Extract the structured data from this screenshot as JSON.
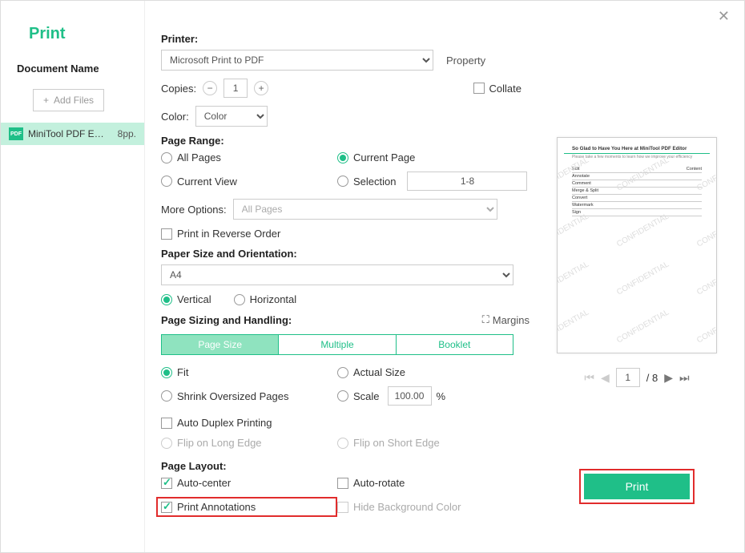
{
  "dialog_title": "Print",
  "left": {
    "doc_label": "Document Name",
    "add_files": "Add Files",
    "file": {
      "name": "MiniTool PDF E…",
      "pages": "8pp."
    }
  },
  "printer": {
    "label": "Printer:",
    "value": "Microsoft Print to PDF",
    "property": "Property"
  },
  "copies": {
    "label": "Copies:",
    "value": "1",
    "collate": "Collate"
  },
  "color": {
    "label": "Color:",
    "value": "Color"
  },
  "page_range": {
    "label": "Page Range:",
    "all": "All Pages",
    "current_page": "Current Page",
    "current_view": "Current View",
    "selection": "Selection",
    "selection_value": "1-8"
  },
  "more_options": {
    "label": "More Options:",
    "value": "All Pages"
  },
  "reverse": "Print in Reverse Order",
  "paper": {
    "label": "Paper Size and Orientation:",
    "size": "A4",
    "vertical": "Vertical",
    "horizontal": "Horizontal"
  },
  "sizing": {
    "label": "Page Sizing and Handling:",
    "margins": "Margins",
    "tab_size": "Page Size",
    "tab_multiple": "Multiple",
    "tab_booklet": "Booklet",
    "fit": "Fit",
    "actual": "Actual Size",
    "shrink": "Shrink Oversized Pages",
    "scale": "Scale",
    "scale_value": "100.00",
    "percent": "%"
  },
  "duplex": {
    "auto": "Auto Duplex Printing",
    "long": "Flip on Long Edge",
    "short": "Flip on Short Edge"
  },
  "layout": {
    "label": "Page Layout:",
    "auto_center": "Auto-center",
    "auto_rotate": "Auto-rotate",
    "print_annot": "Print Annotations",
    "hide_bg": "Hide Background Color"
  },
  "preview": {
    "title": "So Glad to Have You Here at MiniTool PDF Editor",
    "watermark": "CONFIDENTIAL",
    "page": "1",
    "total": "/ 8"
  },
  "print_button": "Print"
}
